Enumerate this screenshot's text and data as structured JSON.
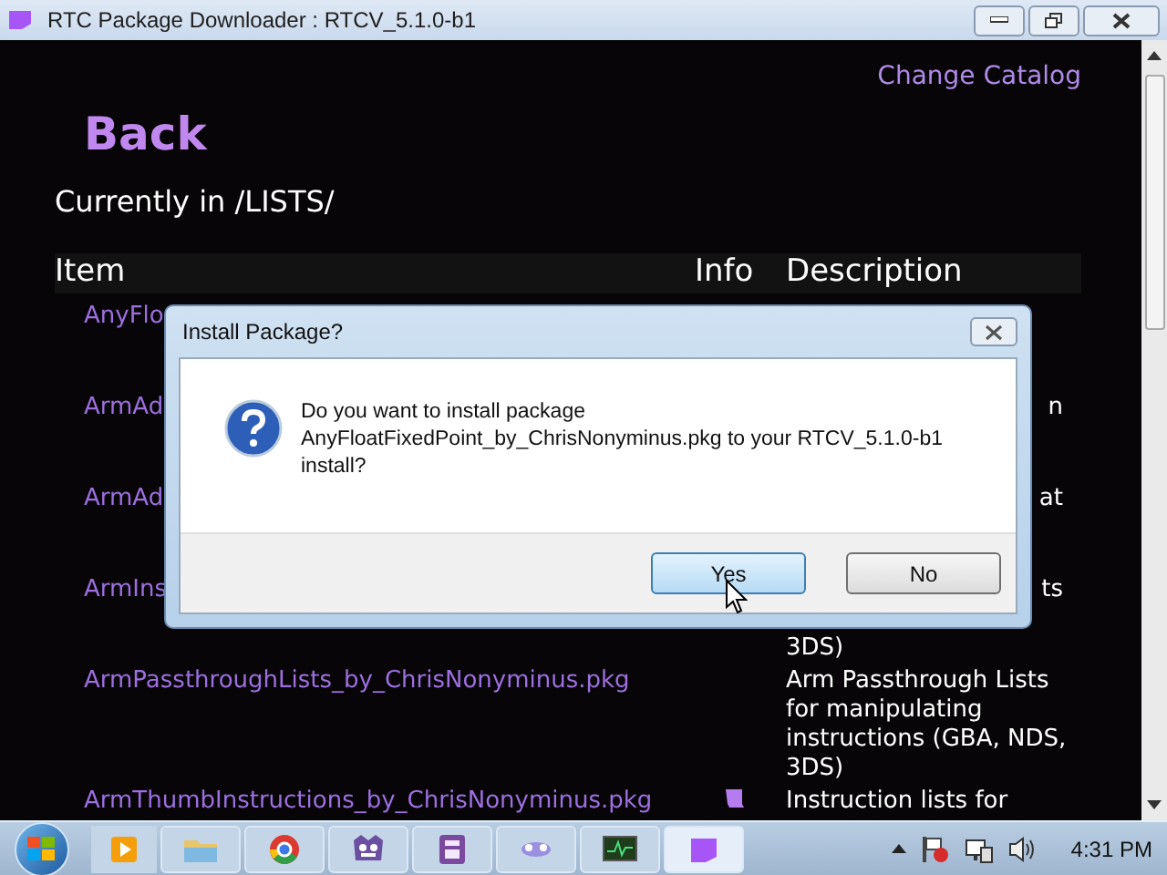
{
  "window": {
    "title": "RTC Package Downloader : RTCV_5.1.0-b1"
  },
  "change_catalog": "Change Catalog",
  "back": "Back",
  "location": "Currently in /LISTS/",
  "table": {
    "columns": [
      "Item",
      "Info",
      "Description"
    ],
    "rows": [
      {
        "item": "AnyFlo",
        "description": []
      },
      {
        "item": "ArmAd",
        "description": [
          {
            "text": "n",
            "cut": true
          }
        ]
      },
      {
        "item": "ArmAd",
        "description": [
          {
            "text": "at",
            "cut": true
          }
        ]
      },
      {
        "item": "ArmIns",
        "description": [
          {
            "text": "ts",
            "cut": true
          },
          {
            "text": "3DS)",
            "cut": false
          }
        ]
      },
      {
        "item": "ArmPassthroughLists_by_ChrisNonyminus.pkg",
        "info_icon": false,
        "description": [
          {
            "text": "Arm Passthrough Lists",
            "cut": false
          },
          {
            "text": "for manipulating",
            "cut": false
          },
          {
            "text": "instructions (GBA, NDS,",
            "cut": false
          },
          {
            "text": "3DS)",
            "cut": false
          }
        ]
      },
      {
        "item": "ArmThumbInstructions_by_ChrisNonyminus.pkg",
        "info_icon": true,
        "description": [
          {
            "text": "Instruction lists for",
            "cut": false
          }
        ]
      }
    ]
  },
  "dialog": {
    "title": "Install Package?",
    "message": "Do you want to install package AnyFloatFixedPoint_by_ChrisNonyminus.pkg to your RTCV_5.1.0-b1 install?",
    "buttons": [
      {
        "label": "Yes",
        "selected": true
      },
      {
        "label": "No",
        "selected": false
      }
    ]
  },
  "taskbar": {
    "items": [
      {
        "kind": "media",
        "active": false
      },
      {
        "kind": "folder",
        "active": false
      },
      {
        "kind": "browser",
        "active": false
      },
      {
        "kind": "monster",
        "active": false
      },
      {
        "kind": "doc",
        "active": false
      },
      {
        "kind": "blur",
        "active": false
      },
      {
        "kind": "monitor",
        "active": false
      },
      {
        "kind": "app",
        "active": true
      }
    ],
    "clock": "4:31 PM"
  }
}
